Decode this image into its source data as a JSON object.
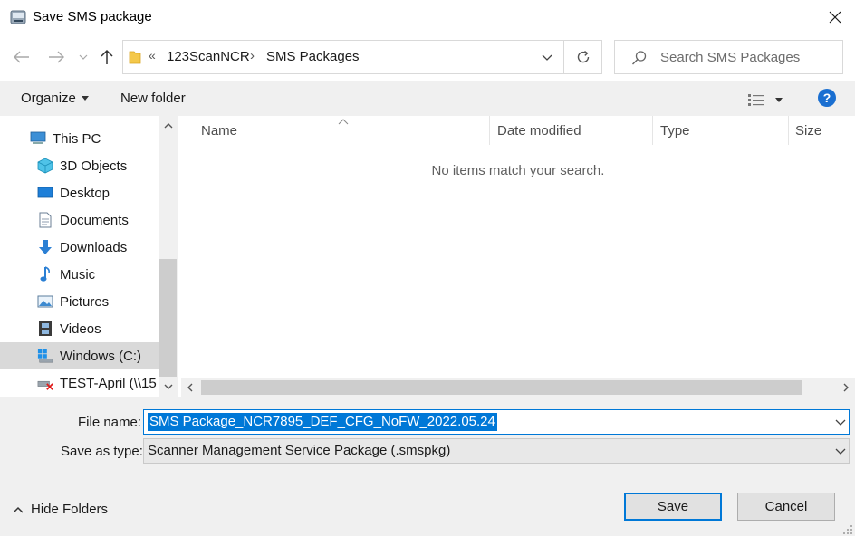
{
  "window": {
    "title": "Save SMS package"
  },
  "address": {
    "overflow_chevron": "«",
    "separator": "›",
    "crumbs": [
      "123ScanNCR",
      "SMS Packages"
    ]
  },
  "search": {
    "placeholder": "Search SMS Packages"
  },
  "toolbar": {
    "organize_label": "Organize",
    "new_folder_label": "New folder",
    "help_label": "?"
  },
  "nav_pane": {
    "items": [
      {
        "label": "This PC",
        "icon": "pc-icon"
      },
      {
        "label": "3D Objects",
        "icon": "cube-icon"
      },
      {
        "label": "Desktop",
        "icon": "desktop-icon"
      },
      {
        "label": "Documents",
        "icon": "documents-icon"
      },
      {
        "label": "Downloads",
        "icon": "download-arrow-icon"
      },
      {
        "label": "Music",
        "icon": "music-note-icon"
      },
      {
        "label": "Pictures",
        "icon": "pictures-icon"
      },
      {
        "label": "Videos",
        "icon": "film-icon"
      },
      {
        "label": "Windows (C:)",
        "icon": "windows-drive-icon"
      },
      {
        "label": "TEST-April (\\\\15",
        "icon": "network-drive-disconnected-icon"
      }
    ],
    "selected_index": 8
  },
  "file_list": {
    "columns": [
      "Name",
      "Date modified",
      "Type",
      "Size"
    ],
    "empty_message": "No items match your search."
  },
  "form": {
    "file_name_label": "File name:",
    "file_name_value": "SMS Package_NCR7895_DEF_CFG_NoFW_2022.05.24",
    "save_as_type_label": "Save as type:",
    "save_as_type_value": "Scanner Management Service Package (.smspkg)"
  },
  "footer": {
    "hide_folders_label": "Hide Folders",
    "save_label": "Save",
    "cancel_label": "Cancel"
  },
  "colors": {
    "accent": "#0078d7",
    "toolbar_bg": "#f0f0f0",
    "selected_nav_bg": "#d9d9d9",
    "help_blue": "#1a6fd1"
  }
}
